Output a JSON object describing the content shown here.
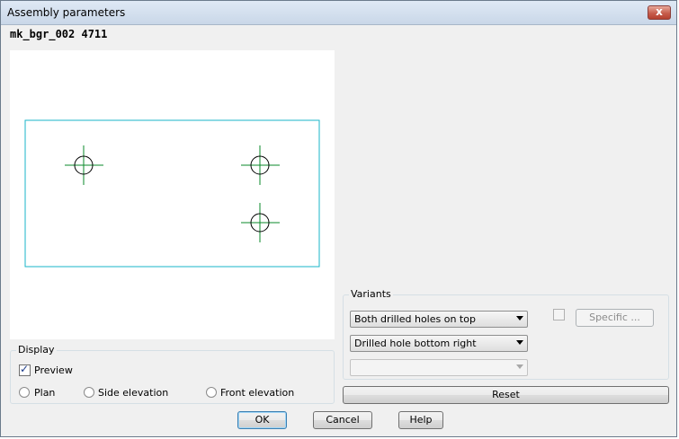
{
  "window": {
    "title": "Assembly parameters",
    "close_label": "x"
  },
  "identifier": "mk_bgr_002   4711",
  "drawing": {
    "outline_color": "#1ab6c8",
    "crosshair_color": "#0a8a2a",
    "hole_color": "#000000"
  },
  "display": {
    "title": "Display",
    "preview_label": "Preview",
    "preview_checked": true,
    "views": [
      {
        "label": "Plan",
        "selected": false
      },
      {
        "label": "Side elevation",
        "selected": false
      },
      {
        "label": "Front elevation",
        "selected": false
      }
    ]
  },
  "variants": {
    "title": "Variants",
    "select1_value": "Both drilled holes on top",
    "select2_value": "Drilled hole bottom right",
    "select3_value": "",
    "specific_label": "Specific ...",
    "specific_checked": false
  },
  "buttons": {
    "reset": "Reset",
    "ok": "OK",
    "cancel": "Cancel",
    "help": "Help"
  }
}
